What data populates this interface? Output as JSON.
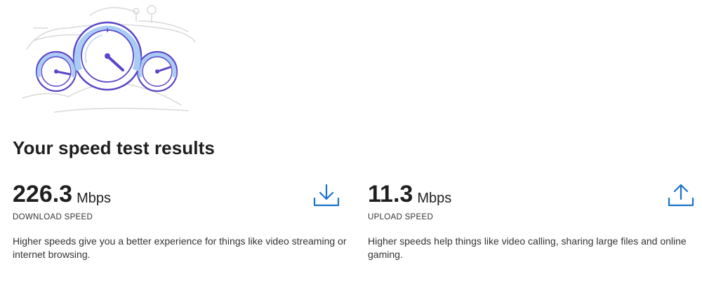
{
  "page": {
    "title": "Your speed test results"
  },
  "download": {
    "value": "226.3",
    "unit": "Mbps",
    "label": "DOWNLOAD SPEED",
    "description": "Higher speeds give you a better experience for things like video streaming or internet browsing.",
    "icon": "download-arrow-icon"
  },
  "upload": {
    "value": "11.3",
    "unit": "Mbps",
    "label": "UPLOAD SPEED",
    "description": "Higher speeds help things like video calling, sharing large files and online gaming.",
    "icon": "upload-arrow-icon"
  },
  "illustration": {
    "icon": "speedometer-gauges-illustration"
  },
  "colors": {
    "accent": "#1a73c8",
    "gauge_stroke": "#5a46c8",
    "gauge_fill": "#a9ccf5"
  }
}
